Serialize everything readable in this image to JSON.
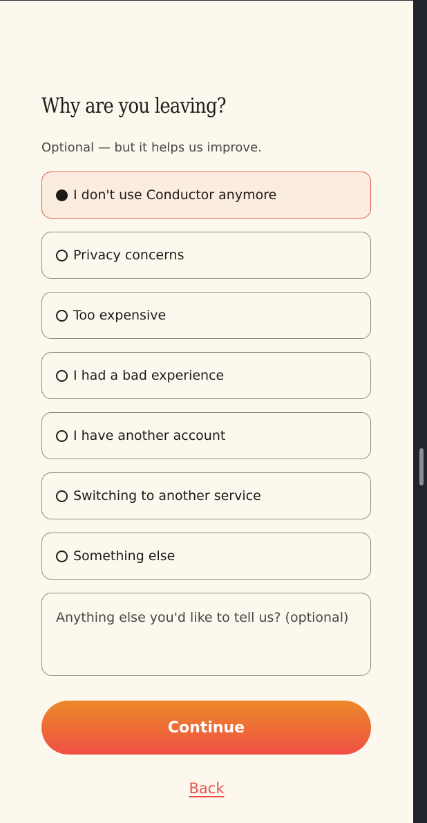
{
  "form": {
    "title": "Why are you leaving?",
    "subtitle": "Optional — but it helps us improve.",
    "options": [
      {
        "label": "I don't use Conductor anymore",
        "selected": true
      },
      {
        "label": "Privacy concerns",
        "selected": false
      },
      {
        "label": "Too expensive",
        "selected": false
      },
      {
        "label": "I had a bad experience",
        "selected": false
      },
      {
        "label": "I have another account",
        "selected": false
      },
      {
        "label": "Switching to another service",
        "selected": false
      },
      {
        "label": "Something else",
        "selected": false
      }
    ],
    "feedback_placeholder": "Anything else you'd like to tell us? (optional)",
    "feedback_value": "",
    "continue_label": "Continue",
    "back_label": "Back"
  },
  "colors": {
    "background": "#fdf8ee",
    "selected_background": "#fbece0",
    "selected_border": "#e65a52",
    "accent_start": "#ec8a2a",
    "accent_end": "#ef4f43",
    "link": "#e55248"
  }
}
